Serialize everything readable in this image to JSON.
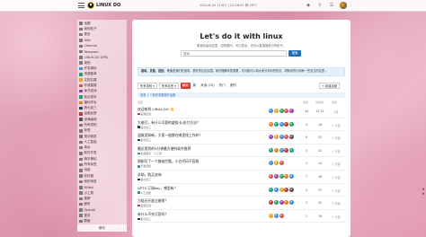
{
  "topbar": {
    "logo_text": "LINUX DO",
    "datetime": "2024-6-20 11:8:2 | 22:26:07 晴 26°C",
    "icons": [
      "hamburger-icon",
      "pin-icon",
      "search-icon",
      "menu-icon",
      "avatar"
    ]
  },
  "sidebar": {
    "items": [
      {
        "label": "话题",
        "color": "#7a7a7a"
      },
      {
        "label": "我的帖子",
        "color": "#7a7a7a"
      },
      {
        "label": "更多",
        "color": "#7a7a7a"
      },
      {
        "label": "Wiki",
        "color": "#7a7a7a"
      },
      {
        "label": "Channel",
        "color": "#7a7a7a"
      },
      {
        "label": "Telegram",
        "color": "#7a7a7a"
      },
      {
        "label": "LINUX DO GPTs",
        "color": "#7a7a7a"
      },
      {
        "label": "类别",
        "color": "#7a7a7a"
      },
      {
        "label": "开发调优",
        "color": "#3b8ed8"
      },
      {
        "label": "资源荟萃",
        "color": "#27a16b"
      },
      {
        "label": "文档共建",
        "color": "#e0a526"
      },
      {
        "label": "非我莫属",
        "color": "#d9534f"
      },
      {
        "label": "读书成诗",
        "color": "#8e44ad"
      },
      {
        "label": "前沿快讯",
        "color": "#16a085"
      },
      {
        "label": "福利羊毛",
        "color": "#e67e22"
      },
      {
        "label": "搞七捻三",
        "color": "#2c3e50"
      },
      {
        "label": "运营反馈",
        "color": "#c0392b"
      },
      {
        "label": "深海幽域",
        "color": "#555555"
      },
      {
        "label": "所有类别",
        "color": "#7a7a7a"
      },
      {
        "label": "标签",
        "color": "#7a7a7a"
      },
      {
        "label": "快问快答",
        "color": "#7a7a7a"
      },
      {
        "label": "人工智能",
        "color": "#7a7a7a"
      },
      {
        "label": "纯水",
        "color": "#7a7a7a"
      },
      {
        "label": "软件开发",
        "color": "#7a7a7a"
      },
      {
        "label": "精华神帖",
        "color": "#7a7a7a"
      },
      {
        "label": "所有标签",
        "color": "#7a7a7a"
      },
      {
        "label": "消息",
        "color": "#7a7a7a"
      },
      {
        "label": "收件箱",
        "color": "#7a7a7a"
      },
      {
        "label": "我的消息",
        "color": "#7a7a7a"
      },
      {
        "label": "Bilibili",
        "color": "#7a7a7a"
      },
      {
        "label": "小工具",
        "color": "#7a7a7a"
      },
      {
        "label": "推荐",
        "color": "#7a7a7a"
      },
      {
        "label": "服务",
        "color": "#7a7a7a"
      },
      {
        "label": "OpenAI",
        "color": "#7a7a7a"
      },
      {
        "label": "更多",
        "color": "#7a7a7a"
      },
      {
        "label": "群组",
        "color": "#7a7a7a"
      }
    ],
    "bottom_label": "聊天"
  },
  "hero": {
    "title": "Let's do it with linux",
    "subtitle": "希望你喜欢这里。如有疑问，可以提出。也可以直接搜索已有帖子。",
    "search_placeholder": "搜索",
    "search_button": "搜索"
  },
  "notice": {
    "bold": "基础、发散、团结、专业",
    "text": "是我们的追求。很好的社区氛围。我们理解你的需要，尽可能可以和大家分享你的知识、帮助你的行动和一些关注的这里..."
  },
  "filters": {
    "dropdown1": "所有类别",
    "dropdown2": "所有标签",
    "tabs": [
      "最新",
      "新",
      "未读 (25)",
      "热门",
      "类别"
    ],
    "active_tab": 0,
    "new_button": "+ 新建话题"
  },
  "new_topics_banner": "查看 1 个新的或更新的话题",
  "table_headers": {
    "topic": "话题",
    "replies": "回复",
    "views": "浏览量",
    "activity": "活动"
  },
  "rows": [
    {
      "title": "欢迎来到 LINUX DO 👋",
      "cat": "运营反馈",
      "cat_color": "#c0392b",
      "tags": "",
      "replies": "44",
      "views": "12.7k",
      "activity": "5月",
      "avatars": [
        "#3b8ed8",
        "#e0a526",
        "#27a16b",
        "#d9534f",
        "#8e44ad"
      ]
    },
    {
      "title": "大佬们，有什么可靠的虚拟卡/支付方法？",
      "cat": "搞七捻三",
      "cat_color": "#2c3e50",
      "tags": "",
      "replies": "4",
      "views": "18",
      "activity": "1 分钟",
      "avatars": [
        "#e67e22",
        "#16a085",
        "#3b8ed8",
        "#c0392b",
        "#27a16b"
      ]
    },
    {
      "title": "温故而知新，大家一般都在哪里找工作的？",
      "cat": "搞七捻三",
      "cat_color": "#2c3e50",
      "tags": "",
      "replies": "6",
      "views": "32",
      "activity": "1 分钟",
      "avatars": [
        "#8e44ad",
        "#e0a526",
        "#3b8ed8",
        "#d9534f",
        "#555555"
      ]
    },
    {
      "title": "最近用到的5分钟最方便的软件推荐",
      "cat": "资源荟萃",
      "cat_color": "#27a16b",
      "tags": "小工具",
      "replies": "5",
      "views": "41",
      "activity": "1 分钟",
      "avatars": [
        "#27a16b",
        "#e67e22",
        "#3b8ed8",
        "#c0392b",
        "#16a085"
      ]
    },
    {
      "title": "刚刚写了一个基础拦截，小白代码不容易",
      "cat": "开发调优",
      "cat_color": "#3b8ed8",
      "tags": "",
      "replies": "2",
      "views": "14",
      "activity": "1 分钟",
      "avatars": [
        "#3b8ed8",
        "#e0a526",
        "#d9534f"
      ]
    },
    {
      "title": "求助，购买咨询",
      "cat": "搞七捻三",
      "cat_color": "#2c3e50",
      "tags": "",
      "replies": "7",
      "views": "38",
      "activity": "2 分钟",
      "avatars": [
        "#d9534f",
        "#8e44ad",
        "#27a16b",
        "#e67e22",
        "#3b8ed8"
      ]
    },
    {
      "title": "GPT4 订阅key，哪里有？",
      "cat": "人工智能",
      "cat_color": "#16a085",
      "tags": "",
      "replies": "9",
      "views": "57",
      "activity": "2 分钟",
      "avatars": [
        "#16a085",
        "#3b8ed8",
        "#e0a526",
        "#c0392b",
        "#555555"
      ]
    },
    {
      "title": "为啥还开放注册呢？",
      "cat": "运营反馈",
      "cat_color": "#c0392b",
      "tags": "",
      "replies": "3",
      "views": "22",
      "activity": "3 分钟",
      "avatars": [
        "#c0392b",
        "#27a16b",
        "#8e44ad",
        "#e67e22",
        "#3b8ed8"
      ]
    },
    {
      "title": "有什么不充可用吗？",
      "cat": "搞七捻三",
      "cat_color": "#2c3e50",
      "tags": "",
      "replies": "2",
      "views": "16",
      "activity": "3 分钟",
      "avatars": [
        "#e0a526",
        "#3b8ed8",
        "#d9534f"
      ]
    }
  ]
}
